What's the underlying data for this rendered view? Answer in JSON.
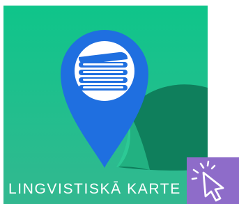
{
  "app": {
    "title": "LINGVISTISKĀ KARTE",
    "icon": "map-pin-books-icon"
  },
  "cursor_badge": {
    "icon": "pointer-click-icon"
  },
  "colors": {
    "background_top": "#13c286",
    "background_bottom": "#2fb88f",
    "pin_blue": "#1f6fe0",
    "pin_inner": "#ffffff",
    "leaf_dark": "#0f7f5c",
    "badge_purple": "#8e6cc9",
    "text": "#ffffff"
  }
}
